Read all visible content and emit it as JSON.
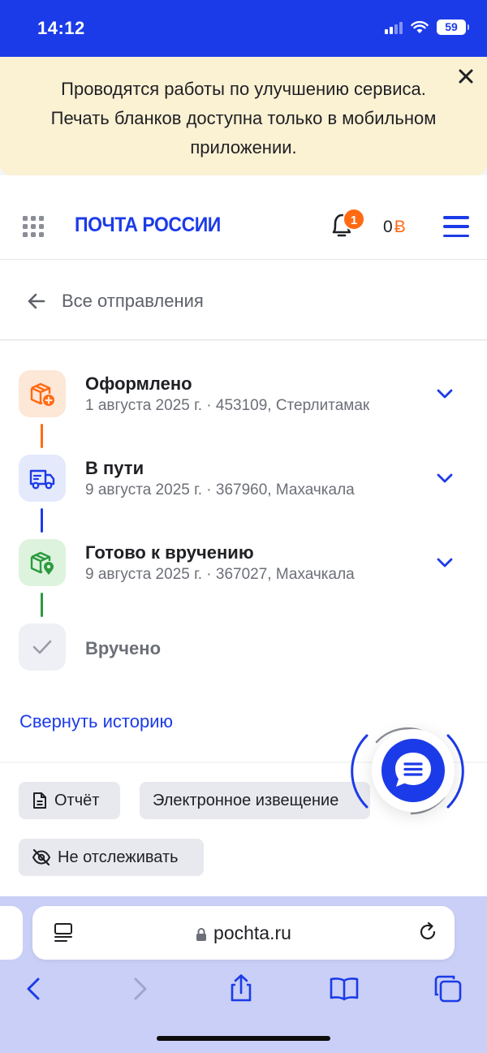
{
  "status_bar": {
    "time": "14:12",
    "battery": "59"
  },
  "notice": {
    "text_lines": [
      "Проводятся работы по улучшению сервиса.",
      "Печать бланков доступна только в мобильном",
      "приложении."
    ],
    "close_icon": "close-icon"
  },
  "header": {
    "logo": "ПОЧТА РОССИИ",
    "notification_count": "1",
    "balance": "0",
    "currency": "Ƀ",
    "accent": "#1c3be8",
    "badge_color": "#ff6a13"
  },
  "back": {
    "label": "Все отправления"
  },
  "timeline": {
    "steps": [
      {
        "title": "Оформлено",
        "subtitle": "1 августа 2025 г. · 453109, Стерлитамак",
        "icon": "package-plus-icon",
        "color": "#ff6a13"
      },
      {
        "title": "В пути",
        "subtitle": "9 августа 2025 г. · 367960, Махачкала",
        "icon": "truck-icon",
        "color": "#1c3be8"
      },
      {
        "title": "Готово к вручению",
        "subtitle": "9 августа 2025 г. · 367027, Махачкала",
        "icon": "package-pin-icon",
        "color": "#2c9a3f"
      },
      {
        "title": "Вручено",
        "subtitle": "",
        "icon": "check-icon",
        "color": "#9a9ca3"
      }
    ],
    "collapse_label": "Свернуть историю"
  },
  "actions": {
    "report": "Отчёт",
    "e_notice": "Электронное извещение",
    "stop_tracking": "Не отслеживать"
  },
  "browser": {
    "url": "pochta.ru"
  }
}
